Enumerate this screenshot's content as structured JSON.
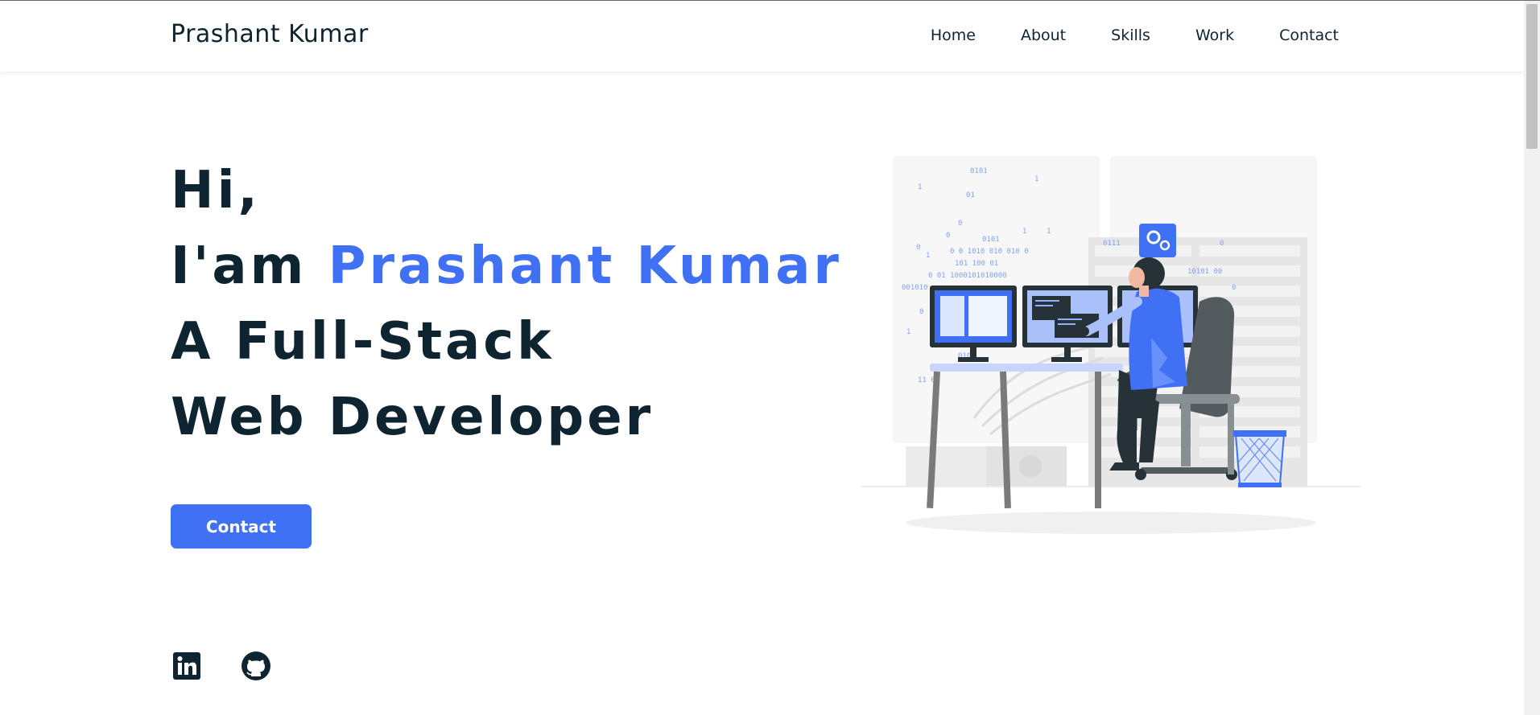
{
  "header": {
    "logo": "Prashant Kumar",
    "nav": [
      "Home",
      "About",
      "Skills",
      "Work",
      "Contact"
    ]
  },
  "hero": {
    "line1": "Hi,",
    "line2_prefix": "I'am",
    "line2_name": "Prashant Kumar",
    "line3": "A Full-Stack",
    "line4": "Web Developer",
    "button": "Contact"
  },
  "social": {
    "icons": [
      "linkedin-icon",
      "github-icon"
    ]
  },
  "illustration": {
    "binary": [
      "0101",
      "1",
      "01",
      "1",
      "0",
      "1",
      "0",
      "0",
      "0101",
      "1",
      "1",
      "0 0 1010 010 010 0",
      "101 100 01",
      "0 01 1000101010000",
      "001010",
      "0",
      "1",
      "0101",
      "11 01",
      "0111",
      "10101 00",
      "0",
      "0"
    ]
  },
  "colors": {
    "accent": "#4070f4",
    "text": "#0e2431"
  }
}
